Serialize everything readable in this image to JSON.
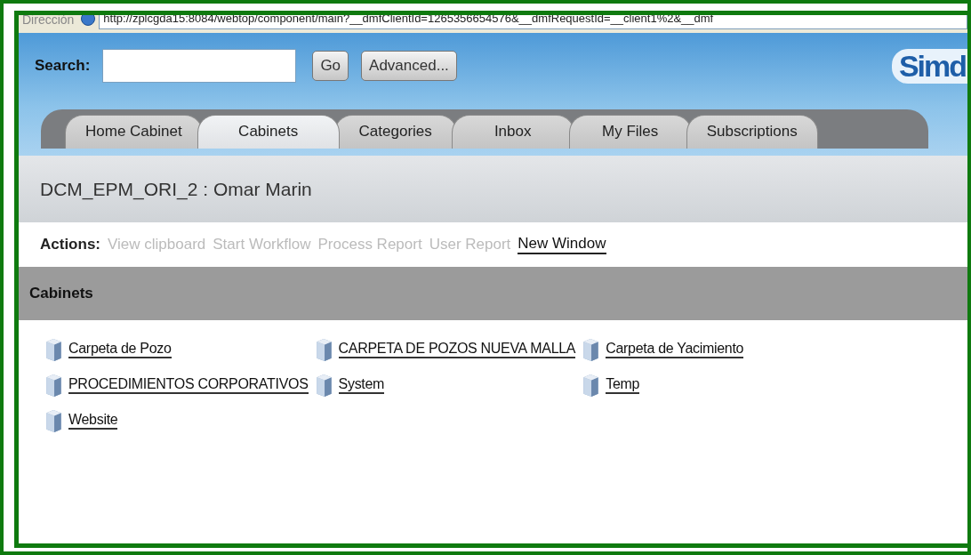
{
  "address_bar": {
    "label": "Dirección",
    "url": "http://zplcgda15:8084/webtop/component/main?__dmfClientId=1265356654576&__dmfRequestId=__client1%2&__dmf"
  },
  "search": {
    "label": "Search:",
    "go": "Go",
    "advanced": "Advanced..."
  },
  "logo": {
    "text": "Simd"
  },
  "tabs": [
    {
      "label": "Home Cabinet",
      "selected": false
    },
    {
      "label": "Cabinets",
      "selected": true
    },
    {
      "label": "Categories",
      "selected": false
    },
    {
      "label": "Inbox",
      "selected": false
    },
    {
      "label": "My Files",
      "selected": false
    },
    {
      "label": "Subscriptions",
      "selected": false
    }
  ],
  "title": "DCM_EPM_ORI_2 : Omar Marin",
  "actions": {
    "label": "Actions:",
    "items": [
      {
        "label": "View clipboard",
        "disabled": true
      },
      {
        "label": "Start Workflow",
        "disabled": true
      },
      {
        "label": "Process Report",
        "disabled": true
      },
      {
        "label": "User Report",
        "disabled": true
      },
      {
        "label": "New Window",
        "disabled": false
      }
    ]
  },
  "section_header": "Cabinets",
  "cabinets": [
    "Carpeta de Pozo",
    "CARPETA DE POZOS NUEVA MALLA",
    "Carpeta de Yacimiento",
    "PROCEDIMIENTOS CORPORATIVOS",
    "System",
    "Temp",
    "Website"
  ]
}
